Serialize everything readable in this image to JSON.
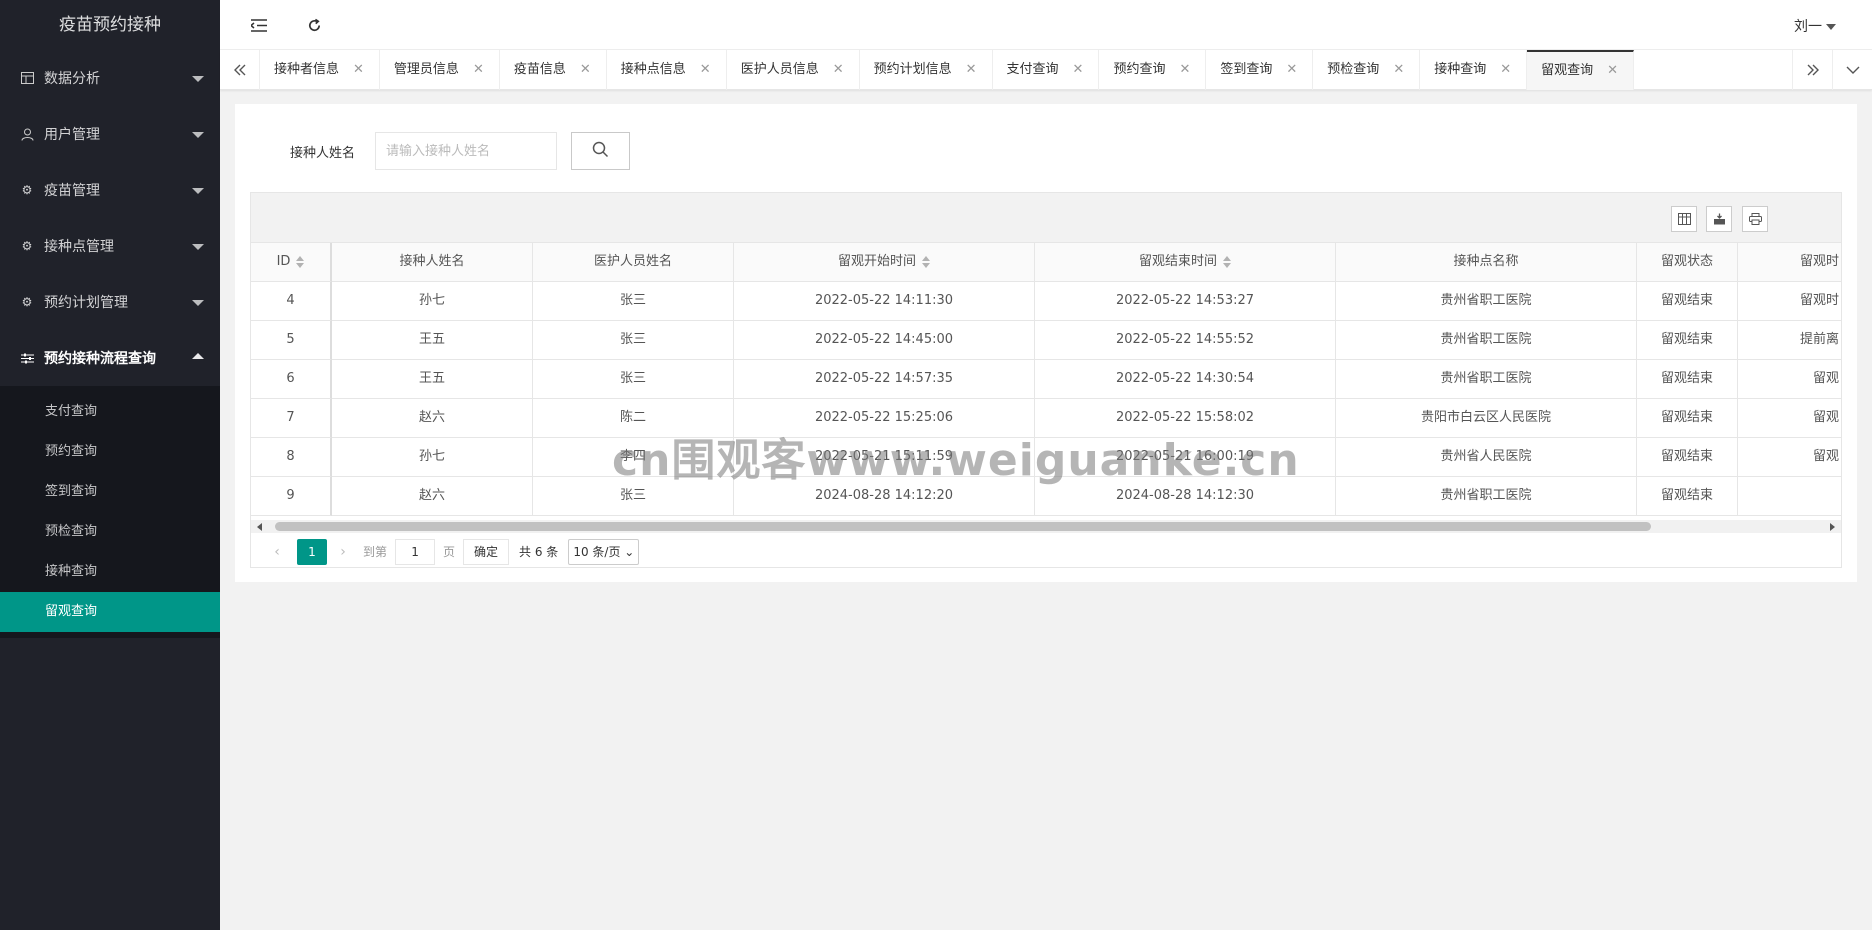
{
  "app": {
    "title": "疫苗预约接种"
  },
  "sidebar": {
    "menus": [
      {
        "label": "数据分析",
        "icon": "table-icon"
      },
      {
        "label": "用户管理",
        "icon": "user-icon"
      },
      {
        "label": "疫苗管理",
        "icon": "gear-icon"
      },
      {
        "label": "接种点管理",
        "icon": "gear-icon"
      },
      {
        "label": "预约计划管理",
        "icon": "gear-icon"
      },
      {
        "label": "预约接种流程查询",
        "icon": "sliders-icon"
      }
    ],
    "submenu": [
      "支付查询",
      "预约查询",
      "签到查询",
      "预检查询",
      "接种查询",
      "留观查询"
    ],
    "active_sub": "留观查询",
    "active_color": "#009688"
  },
  "header": {
    "user": "刘一"
  },
  "tabs": [
    "接种者信息",
    "管理员信息",
    "疫苗信息",
    "接种点信息",
    "医护人员信息",
    "预约计划信息",
    "支付查询",
    "预约查询",
    "签到查询",
    "预检查询",
    "接种查询",
    "留观查询"
  ],
  "active_tab": "留观查询",
  "search": {
    "label": "接种人姓名",
    "placeholder": "请输入接种人姓名",
    "value": ""
  },
  "table": {
    "columns": [
      "ID",
      "接种人姓名",
      "医护人员姓名",
      "留观开始时间",
      "留观结束时间",
      "接种点名称",
      "留观状态",
      "留观时"
    ],
    "rows": [
      [
        "4",
        "孙七",
        "张三",
        "2022-05-22 14:11:30",
        "2022-05-22 14:53:27",
        "贵州省职工医院",
        "留观结束",
        "留观时"
      ],
      [
        "5",
        "王五",
        "张三",
        "2022-05-22 14:45:00",
        "2022-05-22 14:55:52",
        "贵州省职工医院",
        "留观结束",
        "提前离"
      ],
      [
        "6",
        "王五",
        "张三",
        "2022-05-22 14:57:35",
        "2022-05-22 14:30:54",
        "贵州省职工医院",
        "留观结束",
        "留观"
      ],
      [
        "7",
        "赵六",
        "陈二",
        "2022-05-22 15:25:06",
        "2022-05-22 15:58:02",
        "贵阳市白云区人民医院",
        "留观结束",
        "留观"
      ],
      [
        "8",
        "孙七",
        "李四",
        "2022-05-21 15:11:59",
        "2022-05-21 16:00:19",
        "贵州省人民医院",
        "留观结束",
        "留观"
      ],
      [
        "9",
        "赵六",
        "张三",
        "2024-08-28 14:12:20",
        "2024-08-28 14:12:30",
        "贵州省职工医院",
        "留观结束",
        ""
      ]
    ]
  },
  "pager": {
    "current": "1",
    "goto_label": "到第",
    "goto_value": "1",
    "unit": "页",
    "ok": "确定",
    "total": "共 6 条",
    "size": "10 条/页"
  },
  "watermark": "cn围观客www.weiguanke.cn"
}
